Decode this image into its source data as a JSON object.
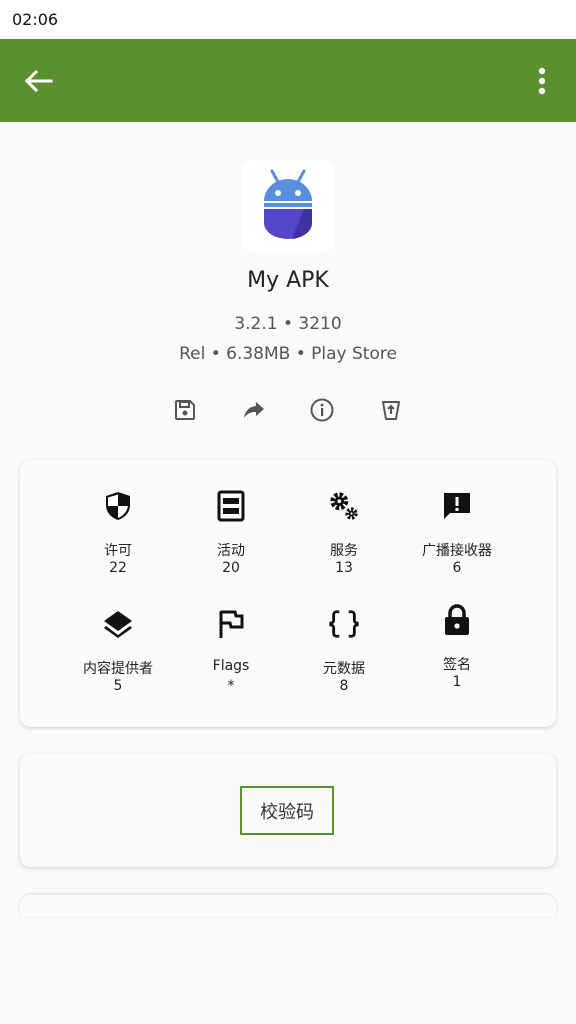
{
  "status_bar": {
    "time": "02:06"
  },
  "app_bar": {
    "color": "#5a9030",
    "back_icon": "arrow-left-icon",
    "menu_icon": "more-vert-icon"
  },
  "app": {
    "name": "My APK",
    "version_line": "3.2.1 • 3210",
    "meta_line": "Rel • 6.38MB • Play Store",
    "icon": "android-robot-icon"
  },
  "actions": [
    {
      "icon": "save-icon"
    },
    {
      "icon": "share-icon"
    },
    {
      "icon": "info-icon"
    },
    {
      "icon": "trash-icon"
    }
  ],
  "components": [
    {
      "label": "许可",
      "count": "22",
      "icon": "shield-icon"
    },
    {
      "label": "活动",
      "count": "20",
      "icon": "activity-window-icon"
    },
    {
      "label": "服务",
      "count": "13",
      "icon": "gears-icon"
    },
    {
      "label": "广播接收器",
      "count": "6",
      "icon": "message-alert-icon"
    },
    {
      "label": "内容提供者",
      "count": "5",
      "icon": "layers-icon"
    },
    {
      "label": "Flags",
      "count": "*",
      "icon": "flag-icon"
    },
    {
      "label": "元数据",
      "count": "8",
      "icon": "code-braces-icon"
    },
    {
      "label": "签名",
      "count": "1",
      "icon": "lock-icon"
    }
  ],
  "checksum": {
    "label": "校验码",
    "border_color": "#5a9030"
  }
}
